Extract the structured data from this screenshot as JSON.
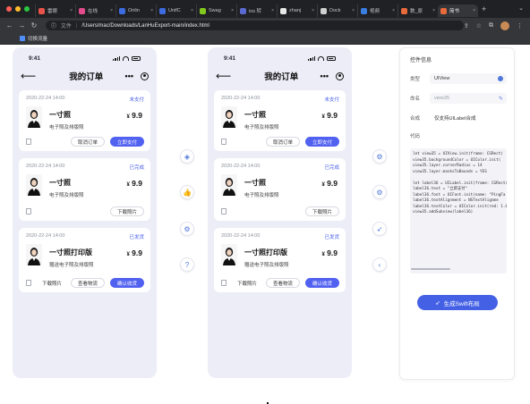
{
  "browser": {
    "tabs": [
      {
        "label": "雷眼",
        "color": "#e8524a",
        "active": false
      },
      {
        "label": "在线",
        "color": "#e34b8c",
        "active": false
      },
      {
        "label": "Onlin",
        "color": "#3d6be0",
        "active": false
      },
      {
        "label": "UnifC",
        "color": "#3d6be0",
        "active": false
      },
      {
        "label": "Swag",
        "color": "#82c91e",
        "active": false
      },
      {
        "label": "ios 转",
        "color": "#5a6ad0",
        "active": false
      },
      {
        "label": "zhanj",
        "color": "#e8e8e8",
        "active": false
      },
      {
        "label": "Dock",
        "color": "#d0d0d0",
        "active": false
      },
      {
        "label": "视频",
        "color": "#3a7ee0",
        "active": false
      },
      {
        "label": "数_原",
        "color": "#e86b3c",
        "active": false
      },
      {
        "label": "简书",
        "color": "#e86b3c",
        "active": true
      }
    ],
    "new_tab": "+",
    "url_prefix": "文件",
    "url": "/Users/mac/Downloads/LanHuExport-main/index.html",
    "bookmark": "切换流量"
  },
  "phones": [
    {
      "time": "9:41",
      "title": "我的订单",
      "orders": [
        {
          "date": "2020-22-24 14:00",
          "status": "未支付",
          "name": "一寸照",
          "desc": "电子照及排版照",
          "price": "9.9",
          "currency": "¥",
          "buttons": [
            "取消订单",
            "立即支付"
          ]
        },
        {
          "date": "2020-22-24 14:00",
          "status": "已完成",
          "name": "一寸照",
          "desc": "电子照及排版照",
          "price": "9.9",
          "currency": "¥",
          "buttons": [
            "下载照片"
          ]
        },
        {
          "date": "2020-22-24 14:00",
          "status": "已发货",
          "name": "一寸照打印版",
          "desc": "赠送电子照及排版照",
          "price": "9.9",
          "currency": "¥",
          "buttons": [
            "下载照片",
            "查看物流",
            "确认收货"
          ]
        }
      ]
    },
    {
      "time": "9:41",
      "title": "我的订单",
      "orders": [
        {
          "date": "2020-22-24 14:00",
          "status": "未支付",
          "name": "一寸照",
          "desc": "电子照及排版照",
          "price": "9.9",
          "currency": "¥",
          "buttons": [
            "取消订单",
            "立即支付"
          ]
        },
        {
          "date": "2020-22-24 14:00",
          "status": "已完成",
          "name": "一寸照",
          "desc": "电子照及排版照",
          "price": "9.9",
          "currency": "¥",
          "buttons": [
            "下载照片"
          ]
        },
        {
          "date": "2020-22-24 14:00",
          "status": "已发货",
          "name": "一寸照打印版",
          "desc": "赠送电子照及排版照",
          "price": "9.9",
          "currency": "¥",
          "buttons": [
            "下载照片",
            "查看物流",
            "确认收货"
          ]
        }
      ]
    }
  ],
  "tools_left": [
    "compass-icon",
    "thumbs-up-icon",
    "gear-icon",
    "help-icon"
  ],
  "tools_right": [
    "gear-icon",
    "gear-icon",
    "swift-icon",
    "chevron-left-icon"
  ],
  "panel": {
    "title": "控件信息",
    "type_label": "类型",
    "type_value": "UIView",
    "name_label": "命名",
    "name_placeholder": "view35",
    "merge_label": "合成",
    "merge_value": "仅支持UILabel合成",
    "code_label": "代码",
    "code_lines": [
      "let view35 = UIView.init(frame: CGRect(",
      "view35.backgroundColor = UIColor.init(",
      "view35.layer.cornerRadius = 14",
      "view35.layer.masksToBounds = YES",
      "",
      "let label36 = UILabel.init(frame: CGRect(",
      "label36.text = \"立即支付\"",
      "label36.font = UIFont.init(name: \"PingFa",
      "label36.textAlignment = NSTextAlignme",
      "label36.textColor = UIColor.init(red: 1.00",
      "view35.addSubview(label36)"
    ],
    "generate_button": "生成Swift布局"
  },
  "colors": {
    "accent": "#5161f0",
    "status_blue": "#4a61e8",
    "phone_bg": "#ededf8"
  }
}
